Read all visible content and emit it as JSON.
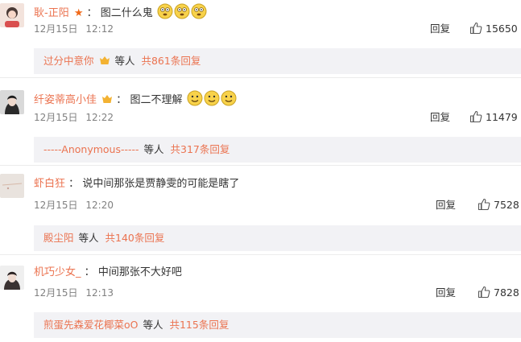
{
  "comments": [
    {
      "username": "耿-正阳",
      "badge": "star",
      "text": "图二什么鬼",
      "emoji_count": 3,
      "date": "12月15日",
      "time": "12:12",
      "reply_label": "回复",
      "likes": "15650",
      "sub": {
        "user": "过分中意你",
        "etc": "等人",
        "count": "共861条回复"
      }
    },
    {
      "username": "纤姿蒂高小佳",
      "badge": "vip",
      "text": "图二不理解",
      "emoji_count": 3,
      "date": "12月15日",
      "time": "12:22",
      "reply_label": "回复",
      "likes": "11479",
      "sub": {
        "user": "-----Anonymous-----",
        "etc": "等人",
        "count": "共317条回复"
      }
    },
    {
      "username": "虾白狂",
      "text": "说中间那张是贾静雯的可能是瞎了",
      "date": "12月15日",
      "time": "12:20",
      "reply_label": "回复",
      "likes": "7528",
      "sub": {
        "user": "殿尘阳",
        "etc": "等人",
        "count": "共140条回复"
      }
    },
    {
      "username": "机巧少女_",
      "text": "中间那张不大好吧",
      "date": "12月15日",
      "time": "12:13",
      "reply_label": "回复",
      "likes": "7828",
      "sub": {
        "user": "煎蛋先森爱花椰菜oO",
        "etc": "等人",
        "count": "共115条回复"
      }
    }
  ],
  "colors": {
    "username": "#eb7350",
    "subbox_bg": "#f2f2f5",
    "meta": "#808080"
  },
  "icons": {
    "like": "thumbs-up-icon",
    "emoji": "smile-emoji-icon",
    "star": "star-badge-icon",
    "vip": "vip-badge-icon"
  }
}
